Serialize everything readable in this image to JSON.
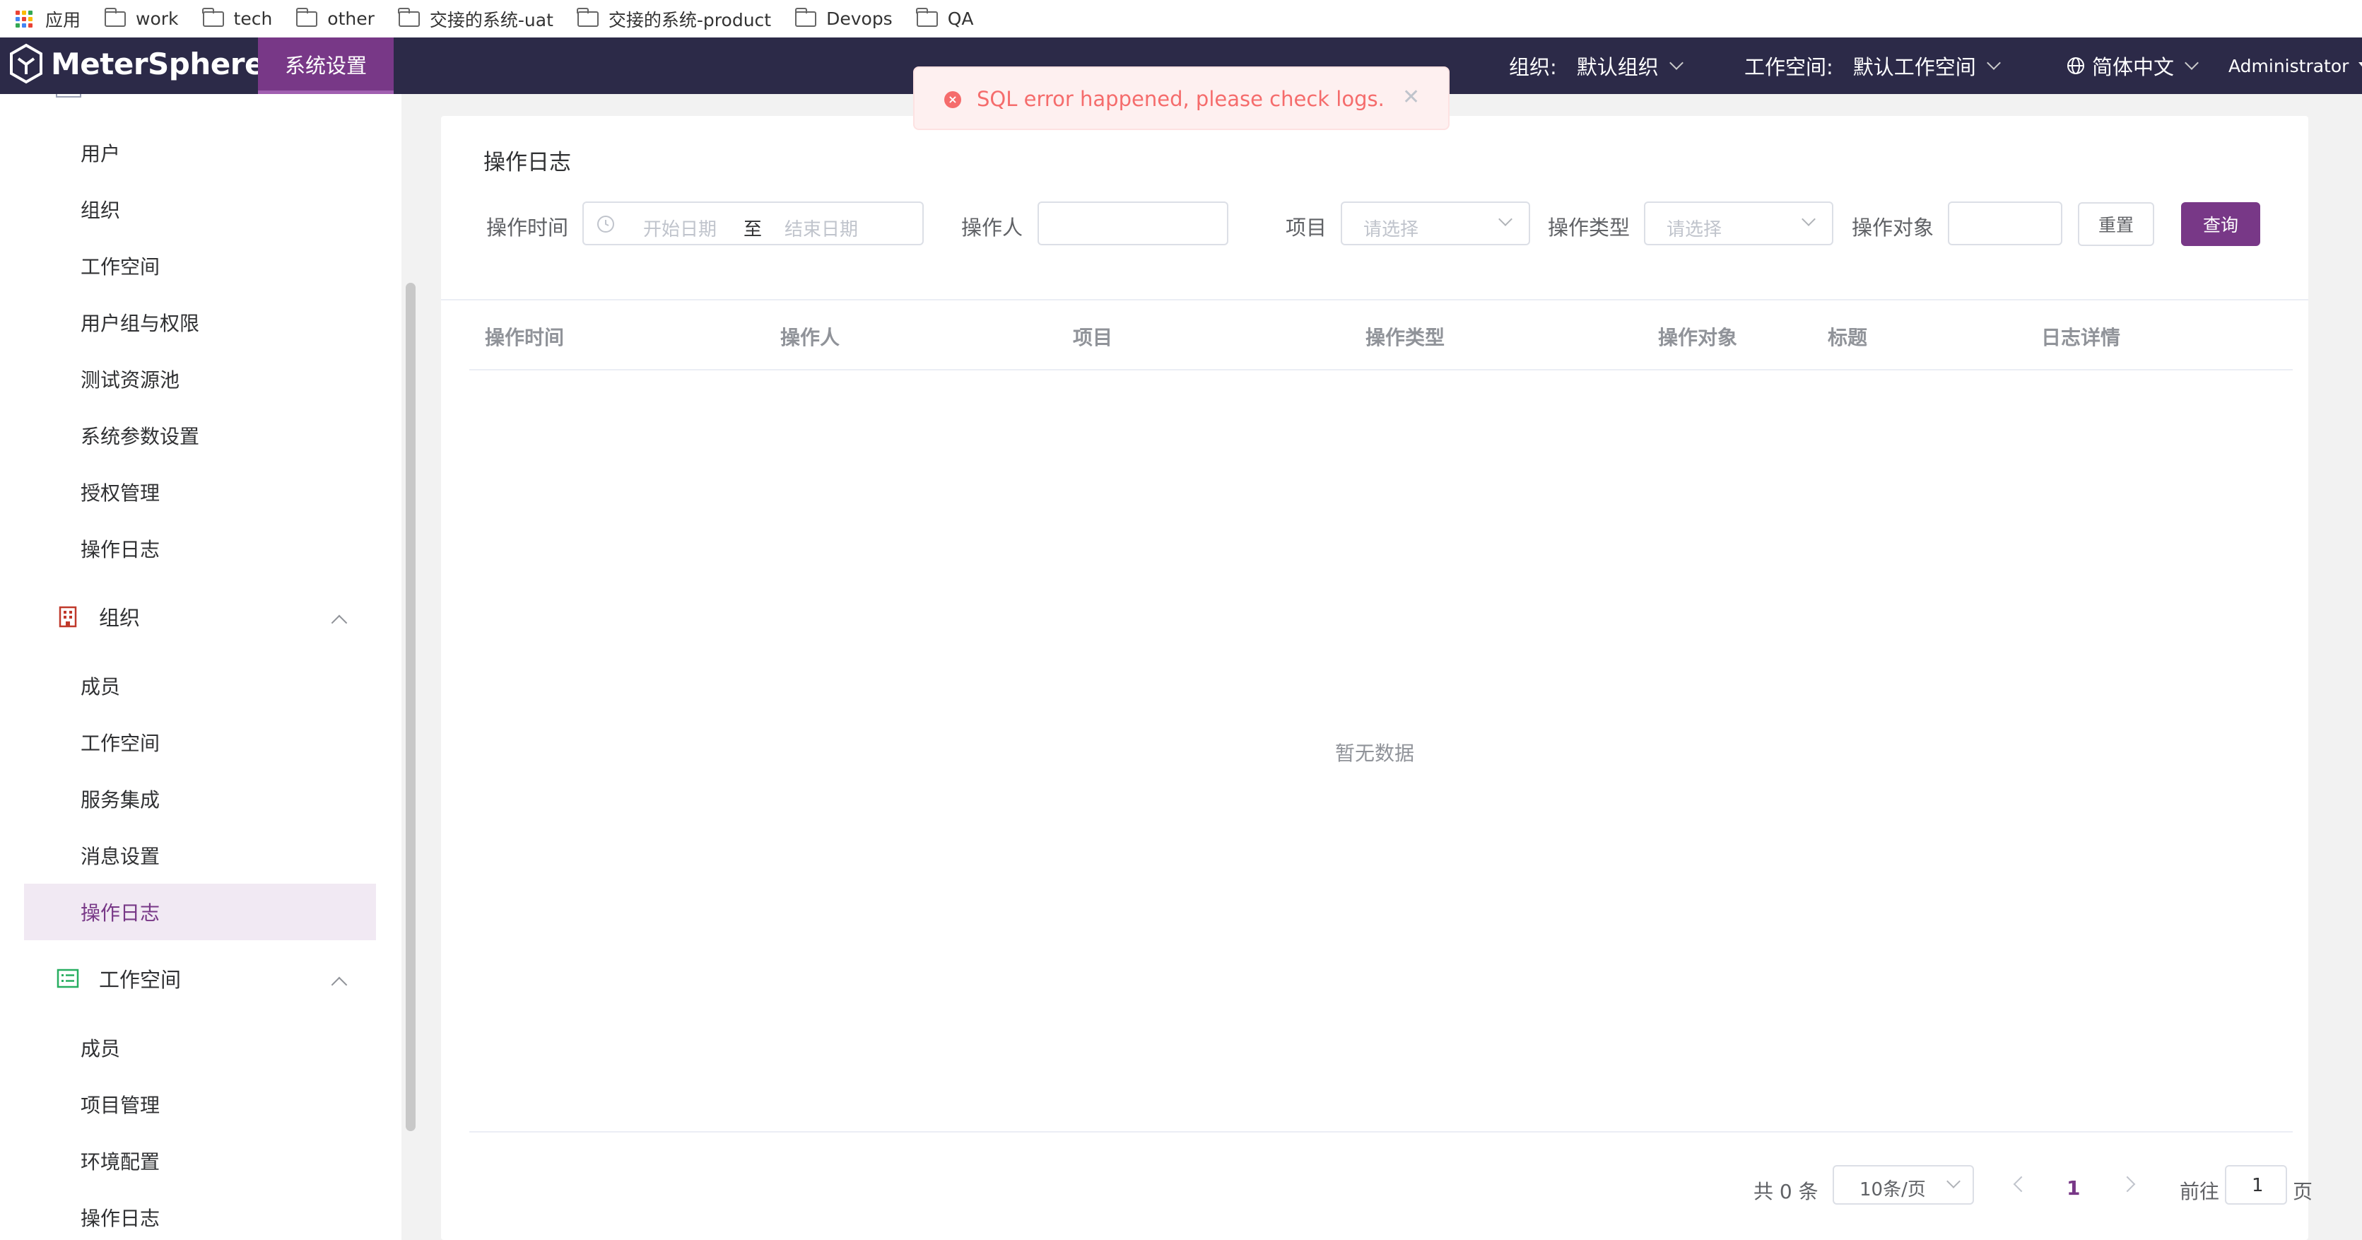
{
  "bookmarks": {
    "apps": "应用",
    "folders": [
      "work",
      "tech",
      "other",
      "交接的系统-uat",
      "交接的系统-product",
      "Devops",
      "QA"
    ]
  },
  "header": {
    "brand": "MeterSphere",
    "active_tab": "系统设置",
    "org_label": "组织:",
    "org_value": "默认组织",
    "workspace_label": "工作空间:",
    "workspace_value": "默认工作空间",
    "language": "简体中文",
    "user": "Administrator"
  },
  "sidebar": {
    "system_items": [
      "用户",
      "组织",
      "工作空间",
      "用户组与权限",
      "测试资源池",
      "系统参数设置",
      "授权管理",
      "操作日志"
    ],
    "org_group": "组织",
    "org_items": [
      "成员",
      "工作空间",
      "服务集成",
      "消息设置",
      "操作日志"
    ],
    "workspace_group": "工作空间",
    "workspace_items": [
      "成员",
      "项目管理",
      "环境配置",
      "操作日志"
    ]
  },
  "toast": {
    "message": "SQL error happened, please check logs."
  },
  "main": {
    "title": "操作日志",
    "filters": {
      "time_label": "操作时间",
      "start_placeholder": "开始日期",
      "range_sep": "至",
      "end_placeholder": "结束日期",
      "operator_label": "操作人",
      "project_label": "项目",
      "project_placeholder": "请选择",
      "type_label": "操作类型",
      "type_placeholder": "请选择",
      "object_label": "操作对象",
      "reset": "重置",
      "query": "查询"
    },
    "columns": [
      "操作时间",
      "操作人",
      "项目",
      "操作类型",
      "操作对象",
      "标题",
      "日志详情"
    ],
    "empty_text": "暂无数据",
    "pagination": {
      "total": "共 0 条",
      "page_size": "10条/页",
      "current_page": "1",
      "goto_label": "前往",
      "goto_value": "1",
      "page_unit": "页"
    }
  },
  "colors": {
    "brand": "#783887",
    "header_bg": "#2c2a48",
    "error": "#f56c6c"
  }
}
